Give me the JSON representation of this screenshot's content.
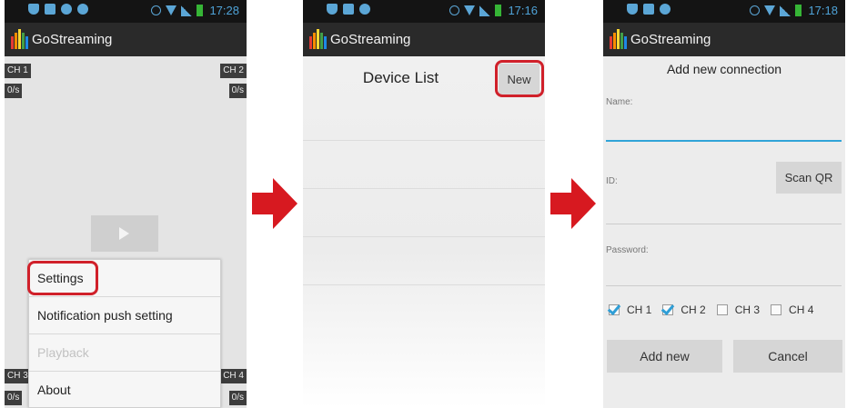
{
  "colors": {
    "highlight": "#d0202a",
    "arrow": "#d71920",
    "checkbox": "#2f9ed6",
    "status_icons": "#5ba6d6",
    "battery": "#36b536"
  },
  "screens": [
    {
      "status_time": "17:28",
      "app_title": "GoStreaming",
      "channels": {
        "ch1": "CH 1",
        "ch2": "CH 2",
        "ch3": "CH 3",
        "ch4": "CH 4",
        "rate": "0/s"
      },
      "play_icon": "play-icon",
      "menu": [
        "Settings",
        "Notification push setting",
        "Playback",
        "About"
      ]
    },
    {
      "status_time": "17:16",
      "app_title": "GoStreaming",
      "title": "Device List",
      "new_button": "New"
    },
    {
      "status_time": "17:18",
      "app_title": "GoStreaming",
      "title": "Add new connection",
      "name_label": "Name:",
      "id_label": "ID:",
      "scan_button": "Scan QR",
      "password_label": "Password:",
      "channels": [
        {
          "label": "CH 1",
          "checked": true
        },
        {
          "label": "CH 2",
          "checked": true
        },
        {
          "label": "CH 3",
          "checked": false
        },
        {
          "label": "CH 4",
          "checked": false
        }
      ],
      "add_button": "Add new",
      "cancel_button": "Cancel"
    }
  ]
}
